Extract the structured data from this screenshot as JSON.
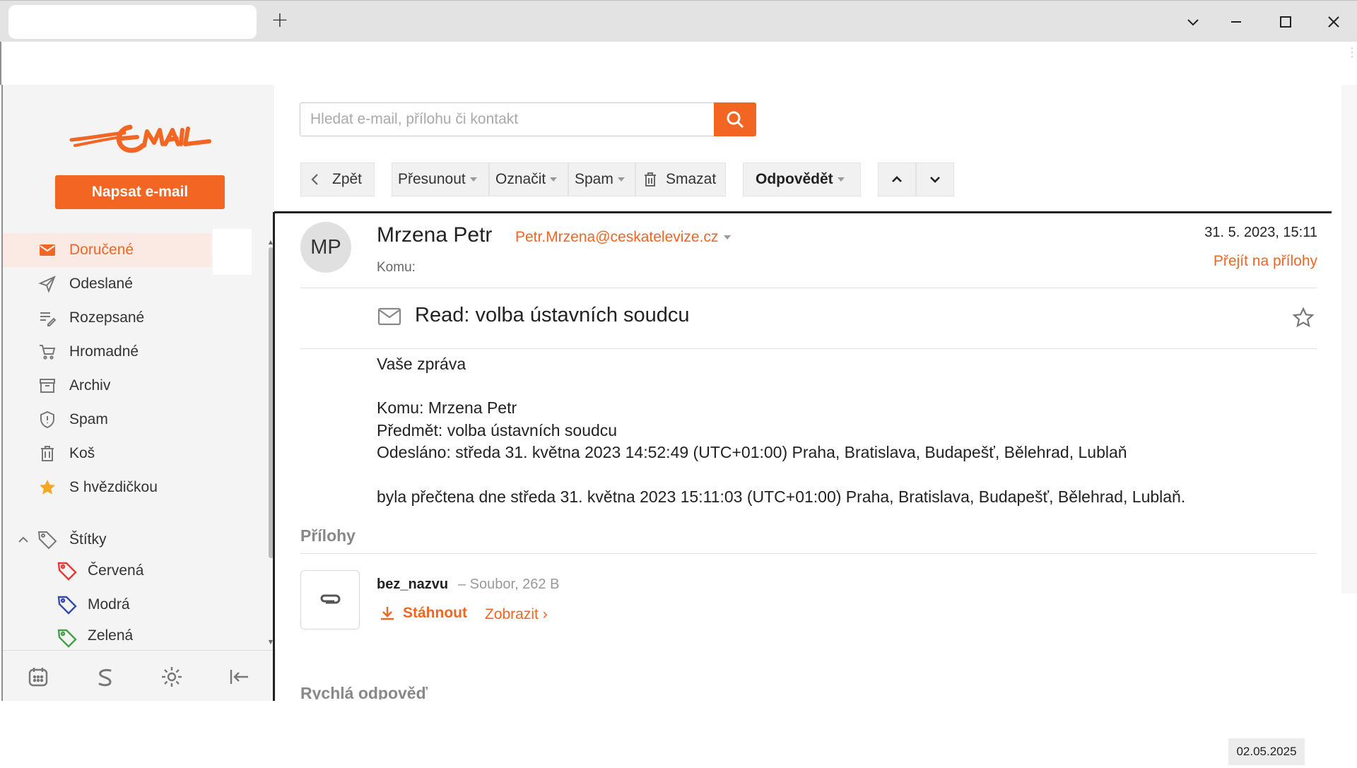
{
  "browser": {
    "new_tab": "+"
  },
  "sidebar": {
    "compose_label": "Napsat e-mail",
    "items": [
      {
        "label": "Doručené",
        "icon": "inbox-icon",
        "active": true
      },
      {
        "label": "Odeslané",
        "icon": "send-icon"
      },
      {
        "label": "Rozepsané",
        "icon": "drafts-icon"
      },
      {
        "label": "Hromadné",
        "icon": "cart-icon"
      },
      {
        "label": "Archiv",
        "icon": "archive-icon"
      },
      {
        "label": "Spam",
        "icon": "shield-icon"
      },
      {
        "label": "Koš",
        "icon": "trash-icon"
      },
      {
        "label": "S hvězdičkou",
        "icon": "star-icon"
      }
    ],
    "labels_title": "Štítky",
    "labels": [
      {
        "label": "Červená",
        "color": "#e53935"
      },
      {
        "label": "Modrá",
        "color": "#3949ab"
      },
      {
        "label": "Zelená",
        "color": "#43a047"
      }
    ]
  },
  "search": {
    "placeholder": "Hledat e-mail, přílohu či kontakt",
    "value": ""
  },
  "toolbar": {
    "back": "Zpět",
    "move": "Přesunout",
    "mark": "Označit",
    "spam": "Spam",
    "delete": "Smazat",
    "reply": "Odpovědět"
  },
  "message": {
    "avatar_initials": "MP",
    "sender_name": "Mrzena Petr",
    "sender_email": "Petr.Mrzena@ceskatelevize.cz",
    "to_label": "Komu:",
    "date": "31. 5. 2023, 15:11",
    "goto_attachments": "Přejít na přílohy",
    "subject": "Read: volba ústavních soudcu",
    "body": {
      "line1": "Vaše zpráva",
      "line2": "Komu: Mrzena Petr",
      "line3": "Předmět: volba ústavních soudcu",
      "line4": "Odesláno: středa 31. května 2023 14:52:49 (UTC+01:00) Praha, Bratislava, Budapešť, Bělehrad, Lublaň",
      "line5": "byla přečtena dne středa 31. května 2023 15:11:03 (UTC+01:00) Praha, Bratislava, Budapešť, Bělehrad, Lublaň."
    },
    "attachments_title": "Přílohy",
    "attachment": {
      "name": "bez_nazvu",
      "meta": "– Soubor, 262 B",
      "download": "Stáhnout",
      "view": "Zobrazit ›"
    },
    "quick_reply_title": "Rychlá odpověď"
  },
  "taskbar": {
    "date": "02.05.2025"
  },
  "colors": {
    "accent": "#f26522",
    "active_bg": "#fbe9e4"
  }
}
